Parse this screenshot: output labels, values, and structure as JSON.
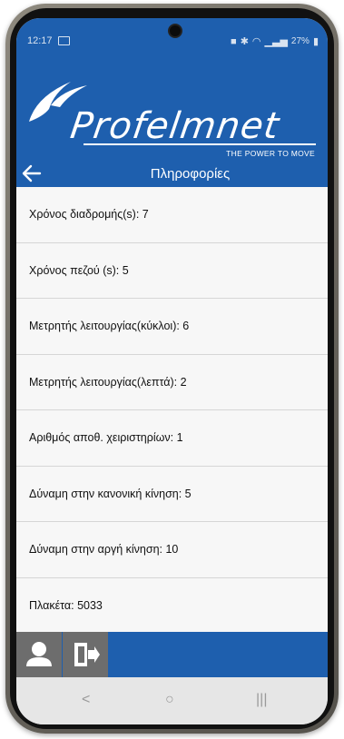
{
  "status_bar": {
    "time": "12:17",
    "battery": "27%"
  },
  "header": {
    "brand": "Profelmnet",
    "slogan": "THE POWER TO MOVE"
  },
  "title_bar": {
    "title": "Πληροφορίες"
  },
  "info_items": [
    {
      "label": "Χρόνος διαδρομής(s): 7"
    },
    {
      "label": "Χρόνος πεζού (s): 5"
    },
    {
      "label": "Μετρητής λειτουργίας(κύκλοι): 6"
    },
    {
      "label": "Μετρητής λειτουργίας(λεπτά): 2"
    },
    {
      "label": "Αριθμός αποθ. χειριστηρίων: 1"
    },
    {
      "label": "Δύναμη στην κανονική κίνηση: 5"
    },
    {
      "label": "Δύναμη στην αργή κίνηση: 10"
    },
    {
      "label": "Πλακέτα: 5033"
    }
  ],
  "bottom_bar": {
    "icons": [
      "user-icon",
      "logout-icon"
    ]
  },
  "nav_bar": {
    "back_glyph": "<",
    "home_glyph": "○",
    "recents_glyph": "|||"
  },
  "colors": {
    "brand_blue": "#1e5fae",
    "bottom_button_gray": "#6d6d6d",
    "list_background": "#f7f7f7"
  }
}
